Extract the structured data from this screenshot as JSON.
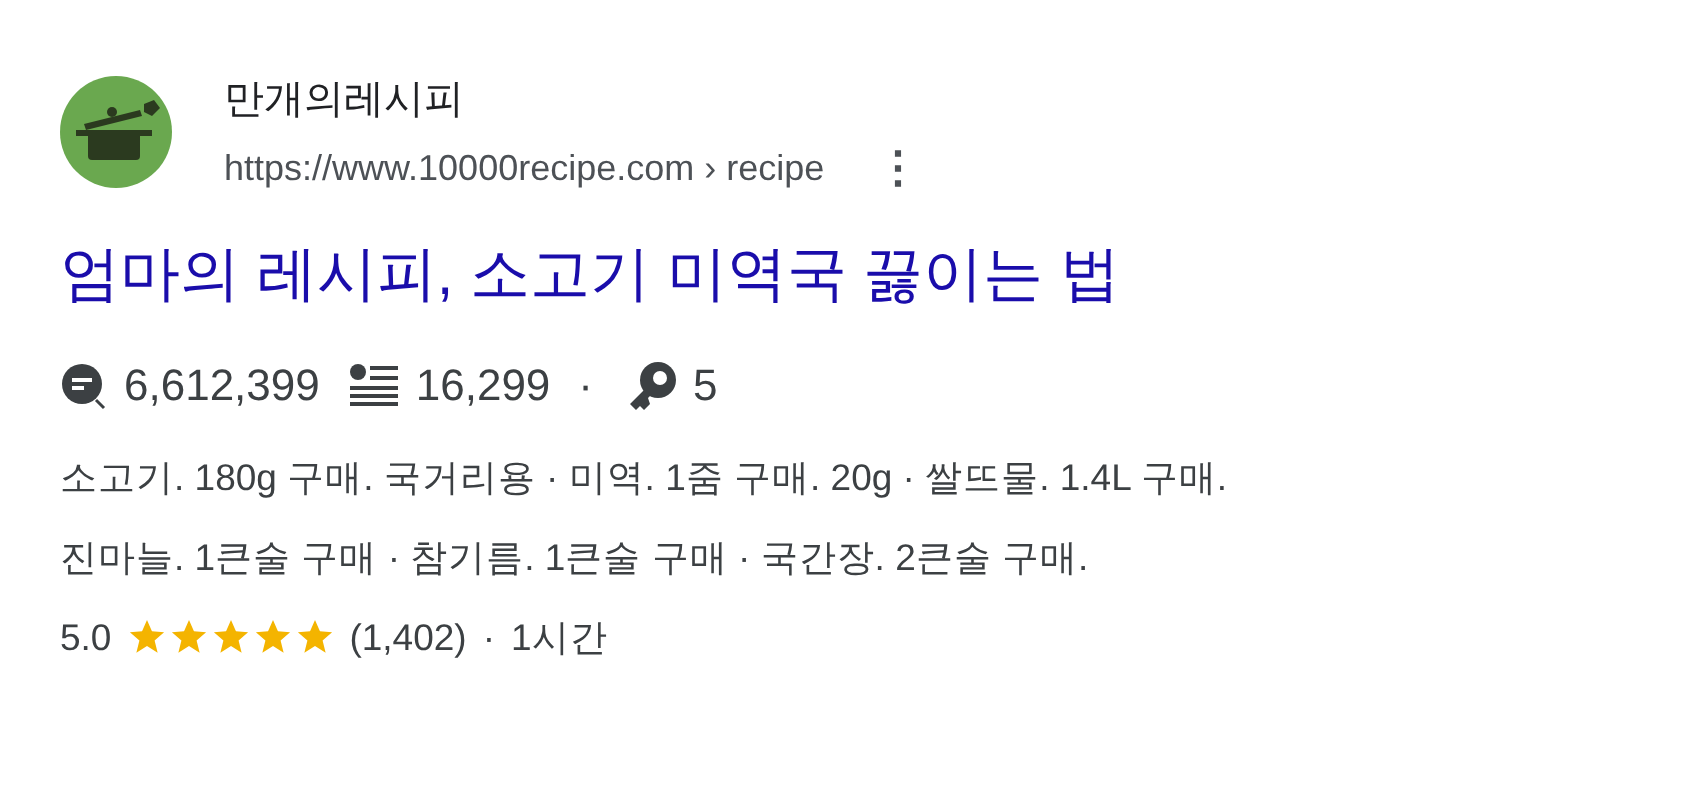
{
  "site": {
    "name": "만개의레시피",
    "url": "https://www.10000recipe.com › recipe",
    "menu": "⋮"
  },
  "title": "엄마의 레시피, 소고기 미역국 끓이는 법",
  "stats": [
    {
      "kind": "views",
      "value": "6,612,399"
    },
    {
      "kind": "scraps",
      "value": "16,299"
    },
    {
      "kind": "sep",
      "value": "·"
    },
    {
      "kind": "reviews",
      "value": "5"
    }
  ],
  "ingredients": [
    "소고기. 180g 구매. 국거리용 · 미역. 1줌 구매. 20g · 쌀뜨물. 1.4L 구매.",
    "진마늘. 1큰술 구매 · 참기름. 1큰술 구매 · 국간장. 2큰술 구매."
  ],
  "rating": {
    "score": "5.0",
    "stars": 5,
    "count": "(1,402)",
    "sep": "·",
    "time": "1시간"
  }
}
